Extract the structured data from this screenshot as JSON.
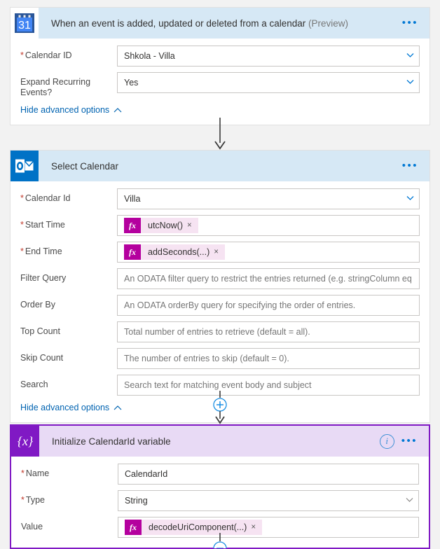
{
  "theme": {
    "header_blue": "#d6e8f5",
    "header_purple": "#e8daf5",
    "selected_border": "#8019c4",
    "accent_link": "#0078d4",
    "token_magenta": "#b4009e",
    "token_pink": "#f6e3f2",
    "required_red": "#c0392b",
    "outlook_blue": "#0072c6"
  },
  "steps": [
    {
      "id": "trigger",
      "icon": "google-calendar-icon",
      "icon_text": "31",
      "title": "When an event is added, updated or deleted from a calendar",
      "title_suffix": "(Preview)",
      "menu": "•••",
      "fields": [
        {
          "label": "Calendar ID",
          "required": true,
          "value": "Shkola - Villa",
          "placeholder": "",
          "control": "dropdown"
        },
        {
          "label": "Expand Recurring Events?",
          "required": false,
          "value": "Yes",
          "placeholder": "",
          "control": "dropdown"
        }
      ],
      "advanced_label": "Hide advanced options"
    },
    {
      "id": "select-calendar",
      "icon": "outlook-icon",
      "icon_text": "O",
      "title": "Select Calendar",
      "title_suffix": "",
      "menu": "•••",
      "fields": [
        {
          "label": "Calendar Id",
          "required": true,
          "value": "Villa",
          "placeholder": "",
          "control": "dropdown"
        },
        {
          "label": "Start Time",
          "required": true,
          "token": "utcNow()",
          "control": "expression"
        },
        {
          "label": "End Time",
          "required": true,
          "token": "addSeconds(...)",
          "control": "expression"
        },
        {
          "label": "Filter Query",
          "required": false,
          "value": "",
          "placeholder": "An ODATA filter query to restrict the entries returned (e.g. stringColumn eq",
          "control": "text"
        },
        {
          "label": "Order By",
          "required": false,
          "value": "",
          "placeholder": "An ODATA orderBy query for specifying the order of entries.",
          "control": "text"
        },
        {
          "label": "Top Count",
          "required": false,
          "value": "",
          "placeholder": "Total number of entries to retrieve (default = all).",
          "control": "text"
        },
        {
          "label": "Skip Count",
          "required": false,
          "value": "",
          "placeholder": "The number of entries to skip (default = 0).",
          "control": "text"
        },
        {
          "label": "Search",
          "required": false,
          "value": "",
          "placeholder": "Search text for matching event body and subject",
          "control": "text"
        }
      ],
      "advanced_label": "Hide advanced options"
    },
    {
      "id": "init-variable",
      "icon": "variable-icon",
      "icon_text": "{x}",
      "title": "Initialize CalendarId variable",
      "title_suffix": "",
      "menu": "•••",
      "info": "i",
      "fields": [
        {
          "label": "Name",
          "required": true,
          "value": "CalendarId",
          "placeholder": "",
          "control": "text"
        },
        {
          "label": "Type",
          "required": true,
          "value": "String",
          "placeholder": "",
          "control": "dropdown"
        },
        {
          "label": "Value",
          "required": false,
          "token": "decodeUriComponent(...)",
          "control": "expression"
        }
      ]
    }
  ],
  "connectors": [
    {
      "id": "connector-1",
      "type": "arrow",
      "has_plus": false
    },
    {
      "id": "connector-2",
      "type": "arrow",
      "has_plus": true
    },
    {
      "id": "connector-3",
      "type": "arrow",
      "has_plus": true
    }
  ],
  "token_remove_glyph": "×"
}
